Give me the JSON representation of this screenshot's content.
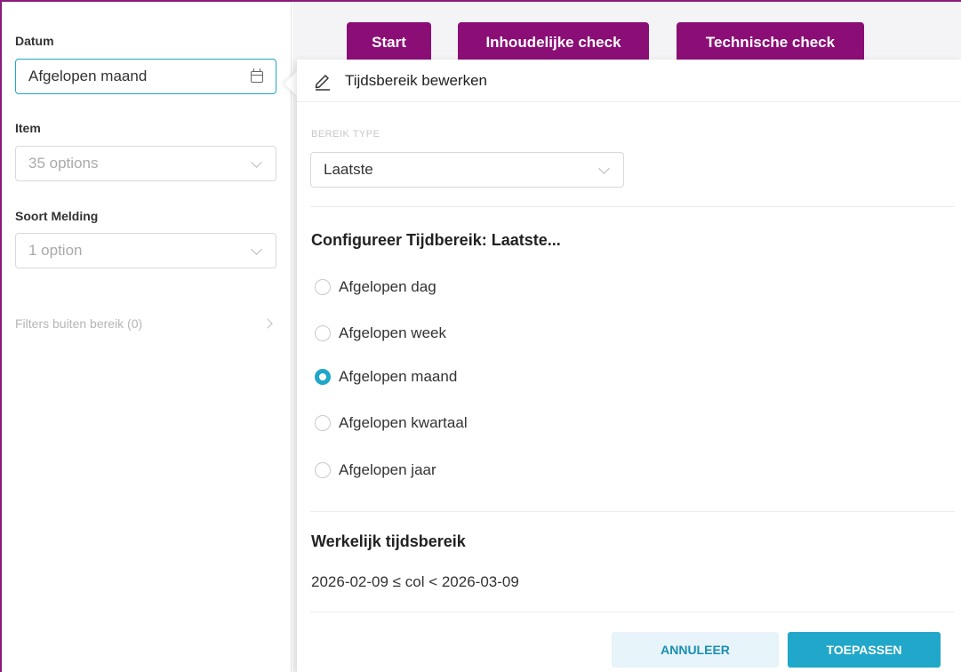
{
  "filters": {
    "datum": {
      "label": "Datum",
      "value": "Afgelopen maand"
    },
    "item": {
      "label": "Item",
      "placeholder": "35 options"
    },
    "soort_melding": {
      "label": "Soort Melding",
      "placeholder": "1 option"
    },
    "outside": {
      "label": "Filters buiten bereik (0)"
    }
  },
  "tabs": [
    {
      "label": "Start"
    },
    {
      "label": "Inhoudelijke check"
    },
    {
      "label": "Technische check"
    }
  ],
  "popover": {
    "title": "Tijdsbereik bewerken",
    "range_type_label": "BEREIK TYPE",
    "range_type_value": "Laatste",
    "config_title": "Configureer Tijdbereik: Laatste...",
    "options": [
      {
        "label": "Afgelopen dag",
        "checked": false
      },
      {
        "label": "Afgelopen week",
        "checked": false
      },
      {
        "label": "Afgelopen maand",
        "checked": true
      },
      {
        "label": "Afgelopen kwartaal",
        "checked": false
      },
      {
        "label": "Afgelopen jaar",
        "checked": false
      }
    ],
    "actual_title": "Werkelijk tijdsbereik",
    "actual_value": "2026-02-09 ≤ col < 2026-03-09",
    "cancel_label": "ANNULEER",
    "apply_label": "TOEPASSEN"
  },
  "colors": {
    "brand": "#8b0e76",
    "accent": "#20a7c9"
  }
}
